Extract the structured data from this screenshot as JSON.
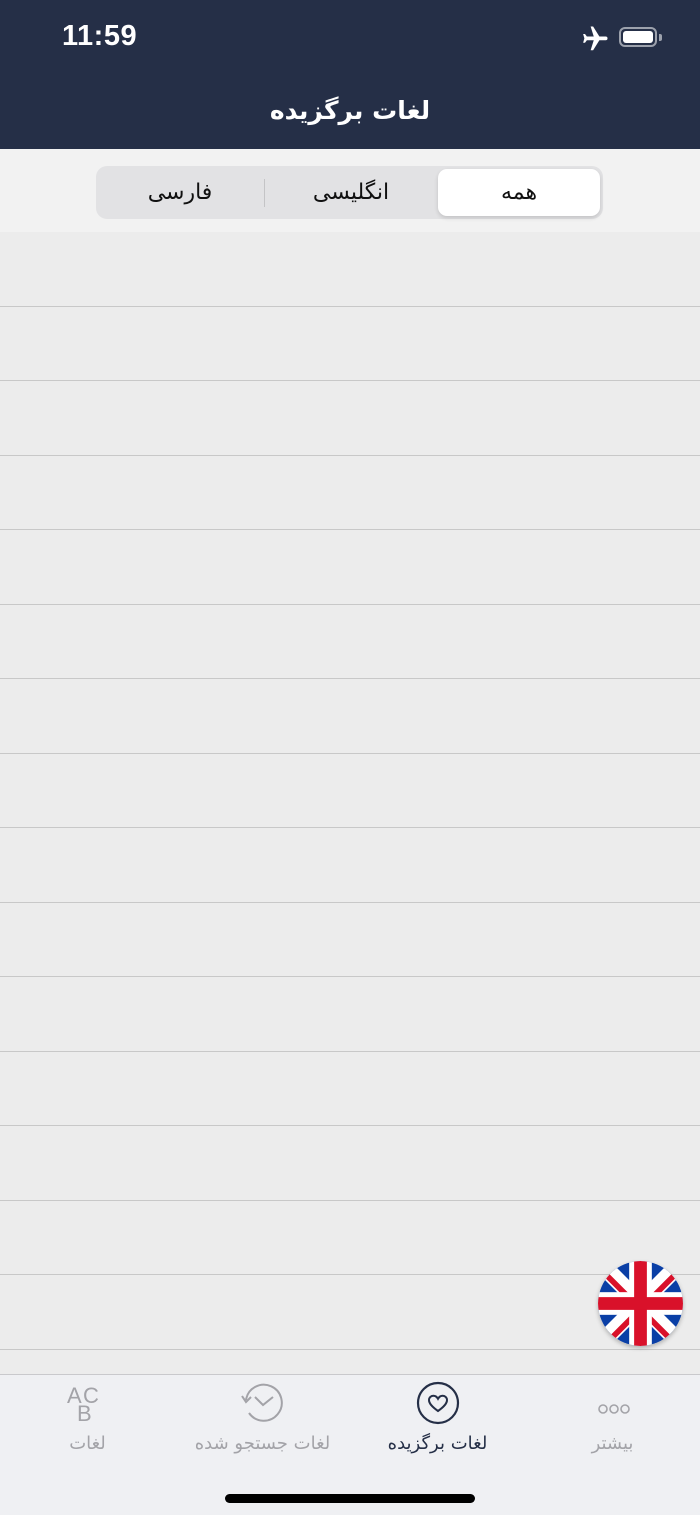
{
  "status_bar": {
    "time": "11:59"
  },
  "header": {
    "title": "لغات برگزیده"
  },
  "segments": {
    "selected": "همه",
    "items": [
      {
        "label": "همه",
        "selected": true
      },
      {
        "label": "انگلیسی",
        "selected": false
      },
      {
        "label": "فارسی",
        "selected": false
      }
    ]
  },
  "tabs": [
    {
      "label": "بیشتر",
      "icon": "more-icon",
      "active": false
    },
    {
      "label": "لغات برگزیده",
      "icon": "heart-icon",
      "active": true
    },
    {
      "label": "لغات جستجو شده",
      "icon": "history-icon",
      "active": false
    },
    {
      "label": "لغات",
      "icon": "abc-icon",
      "active": false
    }
  ],
  "colors": {
    "header_bg": "#252f47",
    "active_tab": "#252f47",
    "inactive_tab": "#a3a3a8",
    "list_bg": "#ececec",
    "flag_blue": "#0a3fa6",
    "flag_red": "#d9112a"
  },
  "flag_button": {
    "icon": "uk-flag-icon"
  }
}
